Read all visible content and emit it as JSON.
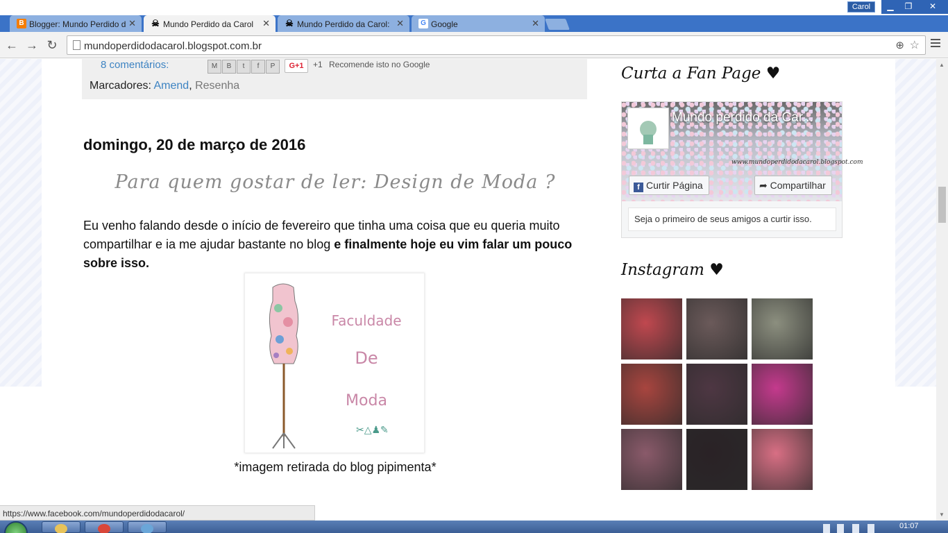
{
  "browser": {
    "tabs": [
      {
        "title": "Blogger: Mundo Perdido d",
        "icon": "blogger-icon",
        "active": false
      },
      {
        "title": "Mundo Perdido da Carol",
        "icon": "skull-icon",
        "active": true
      },
      {
        "title": "Mundo Perdido da Carol:",
        "icon": "skull-icon",
        "active": false
      },
      {
        "title": "Google",
        "icon": "google-icon",
        "active": false
      }
    ],
    "user": "Carol",
    "url": "mundoperdidodacarol.blogspot.com.br",
    "status_url": "https://www.facebook.com/mundoperdidodacarol/"
  },
  "post_footer": {
    "comments": "8 comentários:",
    "share_buttons": [
      "M",
      "B",
      "t",
      "f",
      "P"
    ],
    "gplus": "G+1",
    "plus_one": "+1",
    "recommend": "Recomende isto no Google",
    "labels_prefix": "Marcadores:",
    "label_1": "Amend",
    "label_sep": ",",
    "label_2": "Resenha"
  },
  "post": {
    "date": "domingo, 20 de março de 2016",
    "title": "Para quem gostar de ler: Design de Moda ?",
    "text_normal": "Eu venho falando desde o início de fevereiro que tinha uma coisa que eu queria muito compartilhar e ia me ajudar bastante no blog ",
    "text_bold": "e finalmente hoje eu vim falar um pouco sobre isso.",
    "image_text": [
      "Faculdade",
      "De",
      "Moda"
    ],
    "caption": "*imagem retirada do blog pipimenta*"
  },
  "sidebar": {
    "fanpage_heading": "Curta a Fan Page ♥",
    "fanpage": {
      "name": "Mundo perdido da Car...",
      "cover_url": "www.mundoperdidodacarol.blogspot.com",
      "like_label": "Curtir Página",
      "share_label": "Compartilhar",
      "friends_text": "Seja o primeiro de seus amigos a curtir isso."
    },
    "instagram_heading": "Instagram ♥",
    "instagram_colors": [
      "#c0484f",
      "#6b5a5a",
      "#8c8f7f",
      "#a8453f",
      "#4e3743",
      "#c43a8d",
      "#8a5a6a",
      "#2a2226",
      "#d86f84"
    ]
  },
  "taskbar": {
    "clock": "01:07"
  }
}
